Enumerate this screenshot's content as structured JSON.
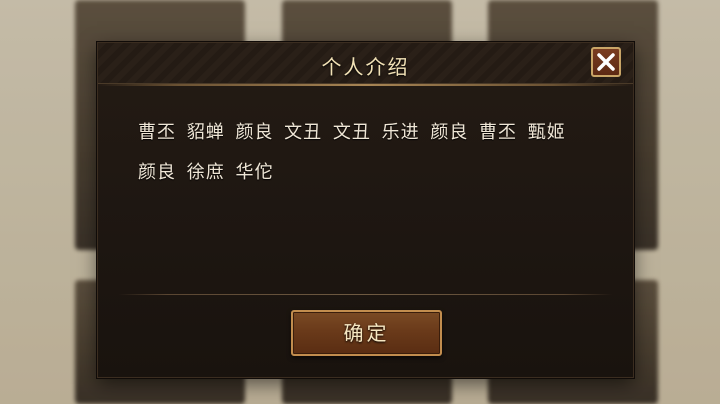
{
  "dialog": {
    "title": "个人介绍",
    "close_icon": "close-icon",
    "intro_line1": "曹丕 貂蝉 颜良 文丑 文丑 乐进 颜良 曹丕 甄姬",
    "intro_line2": "颜良 徐庶 华佗",
    "confirm_label": "确定"
  },
  "colors": {
    "title_text": "#f2e2b6",
    "button_border": "#c28d4e",
    "close_x": "#ffffff"
  }
}
